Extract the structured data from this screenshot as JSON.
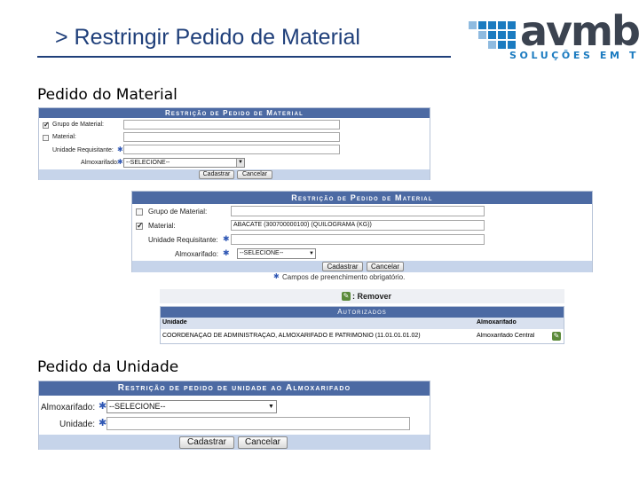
{
  "slide": {
    "title": "> Restringir Pedido de Material",
    "logo": {
      "wordmark": "avmb",
      "tagline": "SOLUÇÕES EM TI",
      "brand_color": "#1b7bc0"
    }
  },
  "sections": {
    "material": "Pedido do Material",
    "unidade": "Pedido da Unidade"
  },
  "form1": {
    "title": "Restrição de Pedido de Material",
    "grupo_label": "Grupo de Material:",
    "grupo_checked": true,
    "material_label": "Material:",
    "material_checked": false,
    "unidade_label": "Unidade Requisitante:",
    "almox_label": "Almoxarifado:",
    "almox_value": "--SELECIONE--",
    "cadastrar": "Cadastrar",
    "cancelar": "Cancelar"
  },
  "form2": {
    "title": "Restrição de Pedido de Material",
    "grupo_label": "Grupo de Material:",
    "grupo_checked": false,
    "material_label": "Material:",
    "material_checked": true,
    "material_value": "ABACATE (300700000100) (QUILOGRAMA (KG))",
    "unidade_label": "Unidade Requisitante:",
    "almox_label": "Almoxarifado:",
    "almox_value": "--SELECIONE--",
    "cadastrar": "Cadastrar",
    "cancelar": "Cancelar",
    "required_note": "Campos de preenchimento obrigatório."
  },
  "restrictions": {
    "remove_legend": ": Remover",
    "title": "Autorizados",
    "columns": [
      "Unidade",
      "Almoxarifado"
    ],
    "rows": [
      {
        "unidade": "COORDENAÇÃO DE ADMINISTRAÇÃO, ALMOXARIFADO E PATRIMÔNIO (11.01.01.01.02)",
        "almoxarifado": "Almoxarifado Central"
      }
    ]
  },
  "form3": {
    "title": "Restrição de pedido de unidade ao Almoxarifado",
    "almox_label": "Almoxarifado:",
    "almox_value": "--SELECIONE--",
    "unidade_label": "Unidade:",
    "cadastrar": "Cadastrar",
    "cancelar": "Cancelar"
  }
}
